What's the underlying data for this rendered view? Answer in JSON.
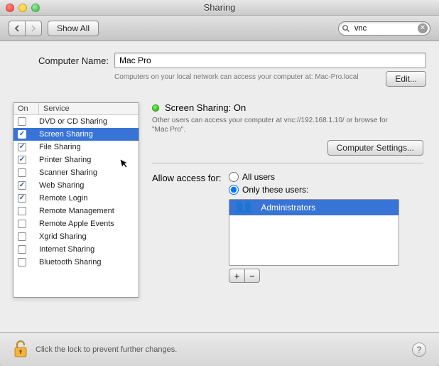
{
  "window": {
    "title": "Sharing"
  },
  "toolbar": {
    "show_all": "Show All",
    "search_value": "vnc"
  },
  "computer": {
    "label": "Computer Name:",
    "value": "Mac Pro",
    "subtext": "Computers on your local network can access your computer at: Mac-Pro.local",
    "edit": "Edit..."
  },
  "services": {
    "headers": {
      "on": "On",
      "service": "Service"
    },
    "items": [
      {
        "label": "DVD or CD Sharing",
        "checked": false,
        "selected": false
      },
      {
        "label": "Screen Sharing",
        "checked": true,
        "selected": true
      },
      {
        "label": "File Sharing",
        "checked": true,
        "selected": false
      },
      {
        "label": "Printer Sharing",
        "checked": true,
        "selected": false
      },
      {
        "label": "Scanner Sharing",
        "checked": false,
        "selected": false
      },
      {
        "label": "Web Sharing",
        "checked": true,
        "selected": false
      },
      {
        "label": "Remote Login",
        "checked": true,
        "selected": false
      },
      {
        "label": "Remote Management",
        "checked": false,
        "selected": false
      },
      {
        "label": "Remote Apple Events",
        "checked": false,
        "selected": false
      },
      {
        "label": "Xgrid Sharing",
        "checked": false,
        "selected": false
      },
      {
        "label": "Internet Sharing",
        "checked": false,
        "selected": false
      },
      {
        "label": "Bluetooth Sharing",
        "checked": false,
        "selected": false
      }
    ]
  },
  "status": {
    "title": "Screen Sharing: On",
    "body": "Other users can access your computer at vnc://192.168.1.10/ or browse for \"Mac Pro\".",
    "settings_button": "Computer Settings..."
  },
  "access": {
    "label": "Allow access for:",
    "options": {
      "all": "All users",
      "only": "Only these users:"
    },
    "selected": "only",
    "users": [
      "Administrators"
    ]
  },
  "footer": {
    "lock_text": "Click the lock to prevent further changes."
  }
}
